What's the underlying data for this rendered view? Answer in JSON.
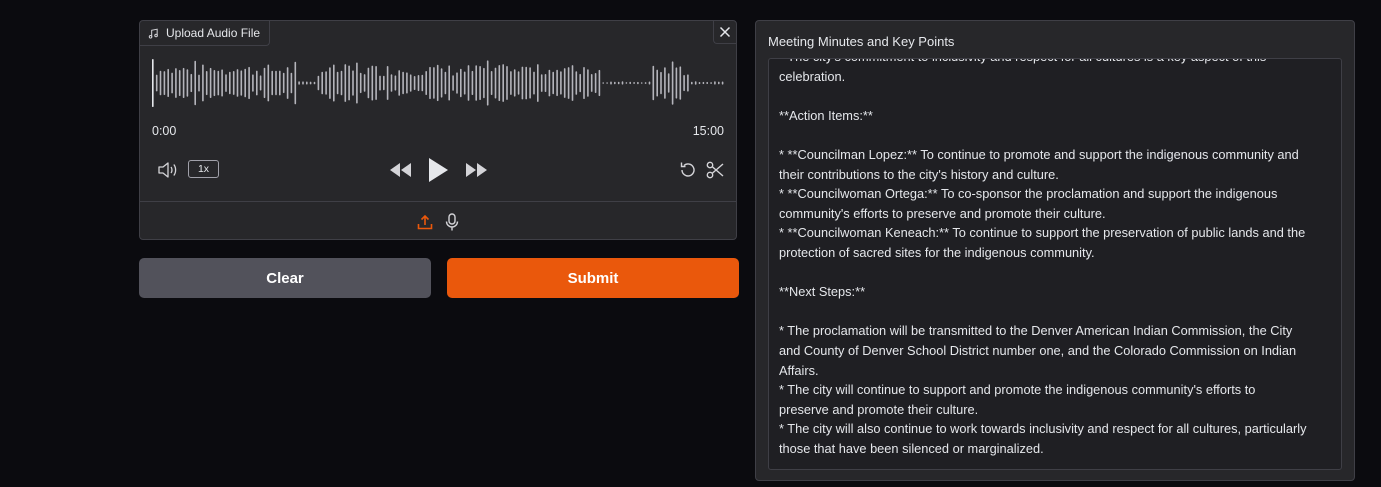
{
  "audio": {
    "upload_label": "Upload Audio File",
    "time_start": "0:00",
    "time_end": "15:00",
    "speed": "1x",
    "icons": {
      "music": "music-note-icon",
      "close": "close-icon",
      "volume": "volume-icon",
      "rewind": "rewind-icon",
      "play": "play-icon",
      "forward": "fast-forward-icon",
      "reset": "reset-icon",
      "trim": "scissors-icon",
      "upload": "upload-icon",
      "microphone": "microphone-icon"
    }
  },
  "buttons": {
    "clear": "Clear",
    "submit": "Submit"
  },
  "output": {
    "label": "Meeting Minutes and Key Points",
    "lines": [
      "* The city's commitment to inclusivity and respect for all cultures is a key aspect of this",
      "celebration.",
      "",
      "**Action Items:**",
      "",
      "* **Councilman Lopez:** To continue to promote and support the indigenous community and",
      "their contributions to the city's history and culture.",
      "* **Councilwoman Ortega:** To co-sponsor the proclamation and support the indigenous",
      "community's efforts to preserve and promote their culture.",
      "* **Councilwoman Keneach:** To continue to support the preservation of public lands and the",
      "protection of sacred sites for the indigenous community.",
      "",
      "**Next Steps:**",
      "",
      "* The proclamation will be transmitted to the Denver American Indian Commission, the City",
      "and County of Denver School District number one, and the Colorado Commission on Indian",
      "Affairs.",
      "* The city will continue to support and promote the indigenous community's efforts to",
      "preserve and promote their culture.",
      "* The city will also continue to work towards inclusivity and respect for all cultures, particularly",
      "those that have been silenced or marginalized."
    ]
  },
  "colors": {
    "accent": "#ea580c",
    "panel": "#27272a",
    "background": "#0b0b0f"
  }
}
